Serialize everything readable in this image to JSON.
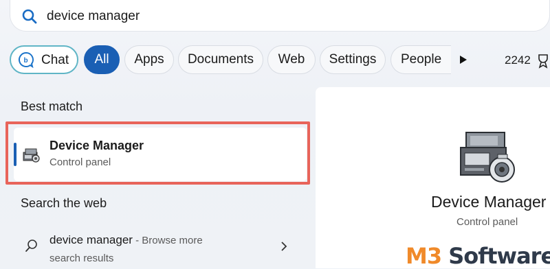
{
  "search": {
    "query": "device manager"
  },
  "filters": {
    "chat_label": "Chat",
    "tabs": [
      "All",
      "Apps",
      "Documents",
      "Web",
      "Settings",
      "People"
    ],
    "active_tab": "All",
    "points": "2242"
  },
  "best_match": {
    "heading": "Best match",
    "title": "Device Manager",
    "subtitle": "Control panel"
  },
  "web": {
    "heading": "Search the web",
    "query": "device manager",
    "suffix": " - Browse more",
    "subtitle": "search results"
  },
  "preview": {
    "title": "Device Manager",
    "subtitle": "Control panel"
  },
  "watermark": {
    "brand_prefix": "M3",
    "brand_rest": " Software"
  },
  "colors": {
    "accent": "#1a5fb4",
    "highlight": "#e8645a",
    "chat_border": "#5fb5c6",
    "watermark_orange": "#f08a2a"
  }
}
